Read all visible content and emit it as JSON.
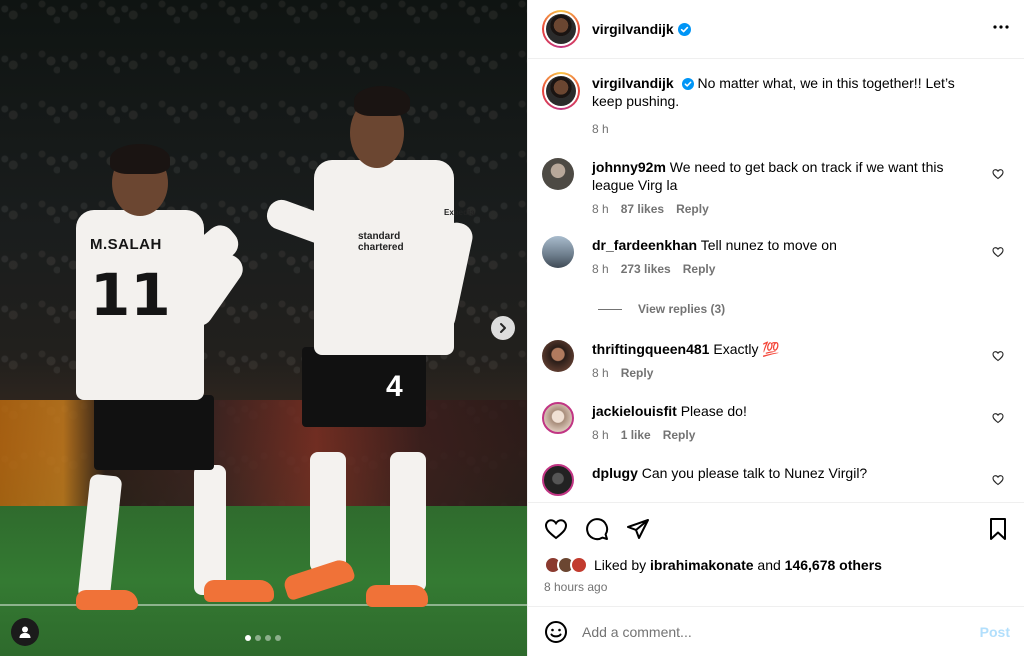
{
  "post": {
    "author": "virgilvandijk",
    "caption": "No matter what, we in this together!! Let’s keep pushing.",
    "caption_time": "8 h",
    "more_icon": "more-horizontal-icon"
  },
  "media": {
    "player_left": {
      "name": "M.SALAH",
      "number": "11"
    },
    "player_right": {
      "number": "4",
      "sponsor": "standard chartered",
      "sleeve": "Expedia"
    },
    "slides": 4,
    "active_slide": 1
  },
  "comments": [
    {
      "user": "johnny92m",
      "text": "We need to get back on track if we want this league Virg la",
      "time": "8 h",
      "likes": "87 likes",
      "reply": "Reply",
      "avatar_color": "#4d4a44"
    },
    {
      "user": "dr_fardeenkhan",
      "text": "Tell nunez to move on",
      "time": "8 h",
      "likes": "273 likes",
      "reply": "Reply",
      "avatar_color": "#8aa0b6",
      "replies": "View replies (3)"
    },
    {
      "user": "thriftingqueen481",
      "text": "Exactly 💯",
      "time": "8 h",
      "likes": "",
      "reply": "Reply",
      "avatar_color": "#5a3a2e"
    },
    {
      "user": "jackielouisfit",
      "text": "Please do!",
      "time": "8 h",
      "likes": "1 like",
      "reply": "Reply",
      "avatar_color": "#d9c6b7"
    },
    {
      "user": "dplugy",
      "text": "Can you please talk to Nunez Virgil?",
      "time": "",
      "likes": "",
      "reply": "",
      "avatar_color": "#222222"
    }
  ],
  "likes": {
    "prefix": "Liked by",
    "user": "ibrahimakonate",
    "and": "and",
    "count": "146,678 others"
  },
  "posted_ago": "8 hours ago",
  "comment_box": {
    "placeholder": "Add a comment...",
    "post_label": "Post"
  },
  "colors": {
    "verified": "#0095f6",
    "post_disabled": "#b2dffc",
    "meta": "#737373"
  }
}
